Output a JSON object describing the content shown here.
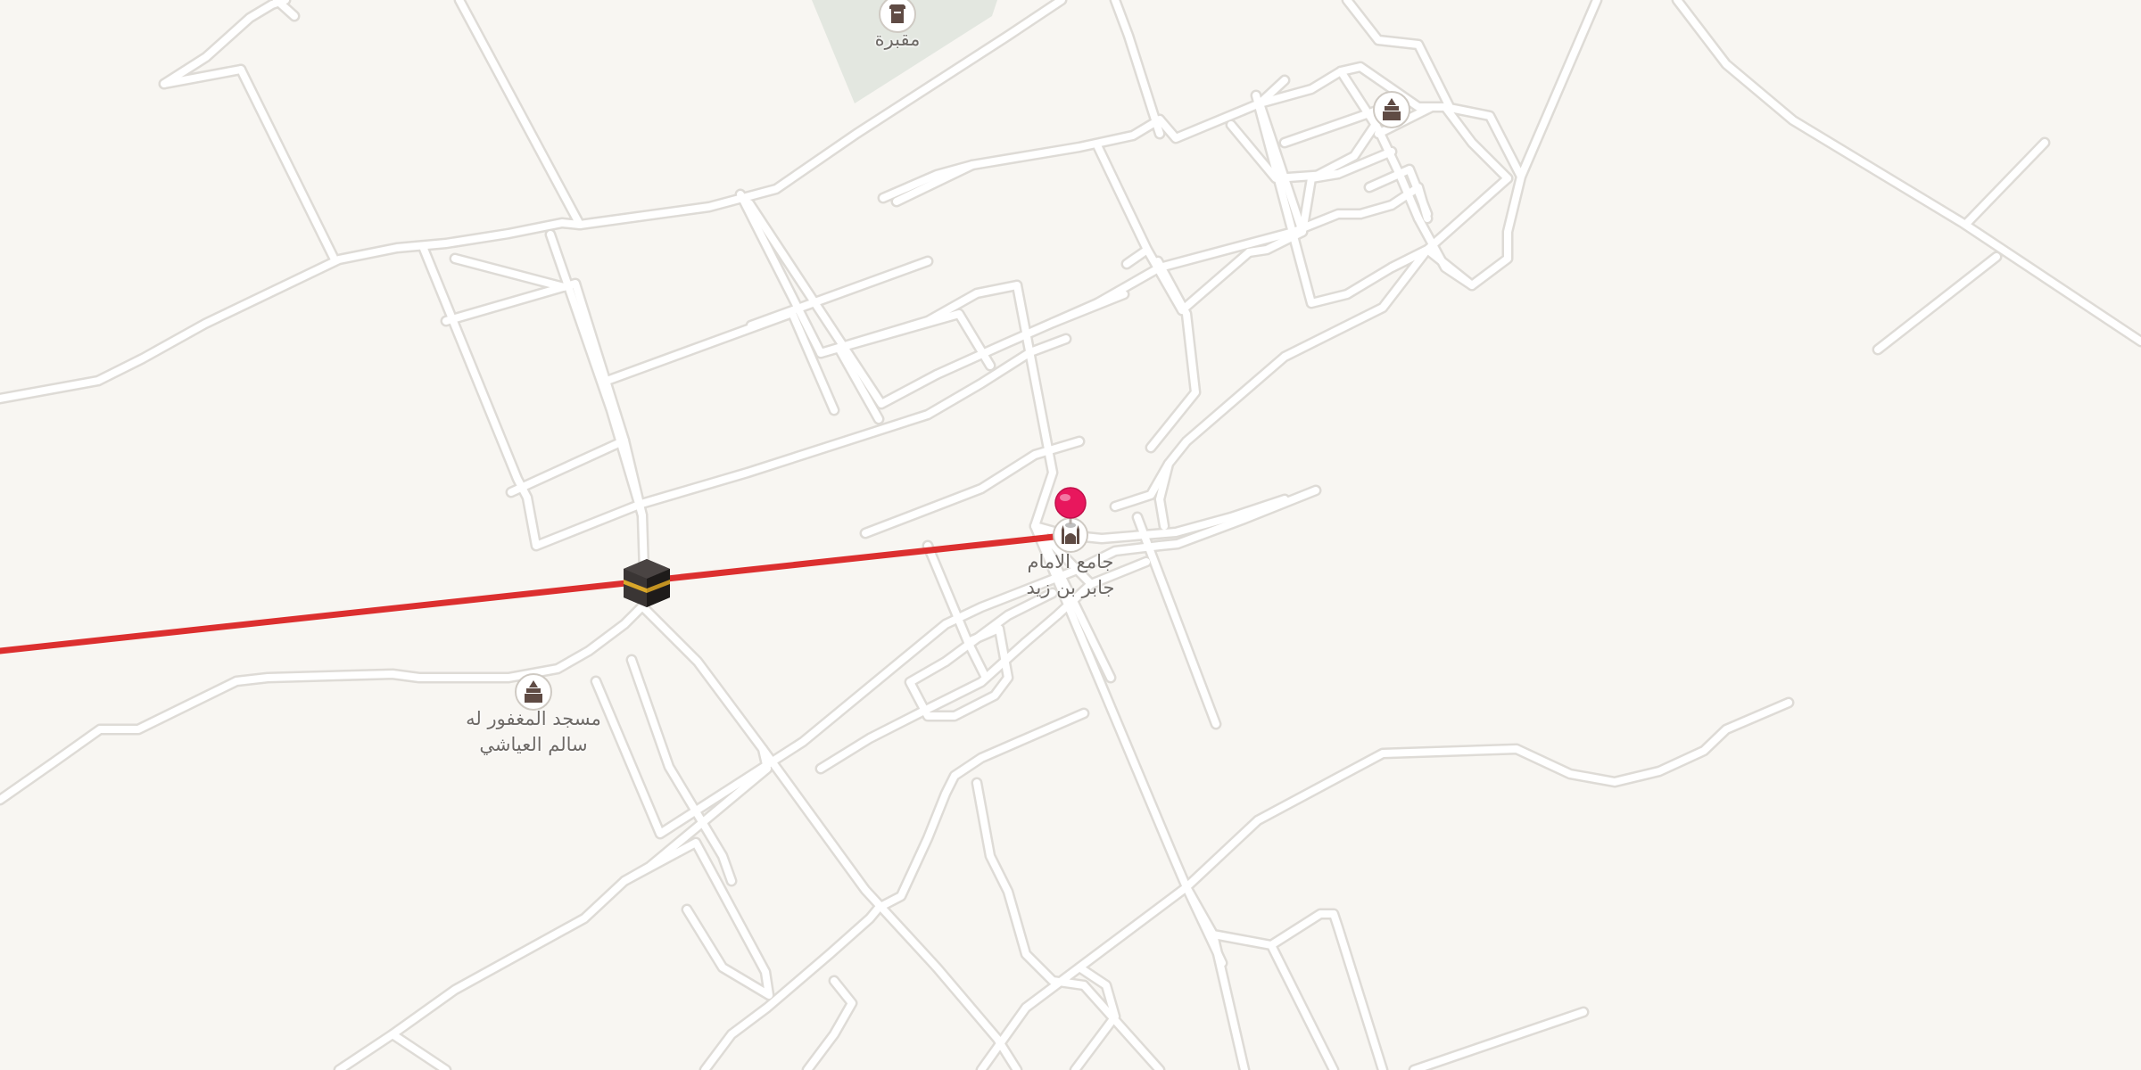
{
  "map": {
    "background_color": "#f8f6f2",
    "road_color": "#ffffff",
    "road_casing_color": "#dedbd6",
    "cemetery_color": "#e3e7e0",
    "route_color": "#dc2f2f",
    "pin_color": "#e8175d"
  },
  "pois": {
    "cemetery": {
      "label": "مقبرة",
      "icon": "cemetery-icon"
    },
    "mosque_imam_jabir": {
      "label_line1": "جامع الامام",
      "label_line2": "جابر بن زيد",
      "icon": "mosque-icon"
    },
    "mosque_salim": {
      "label_line1": "مسجد المغفور له",
      "label_line2": "سالم العياشي",
      "icon": "mosque-icon"
    },
    "mosque_northeast": {
      "icon": "mosque-icon"
    }
  },
  "route": {
    "qibla_marker_icon": "kaaba-icon",
    "destination_pin_icon": "location-pin-icon"
  }
}
